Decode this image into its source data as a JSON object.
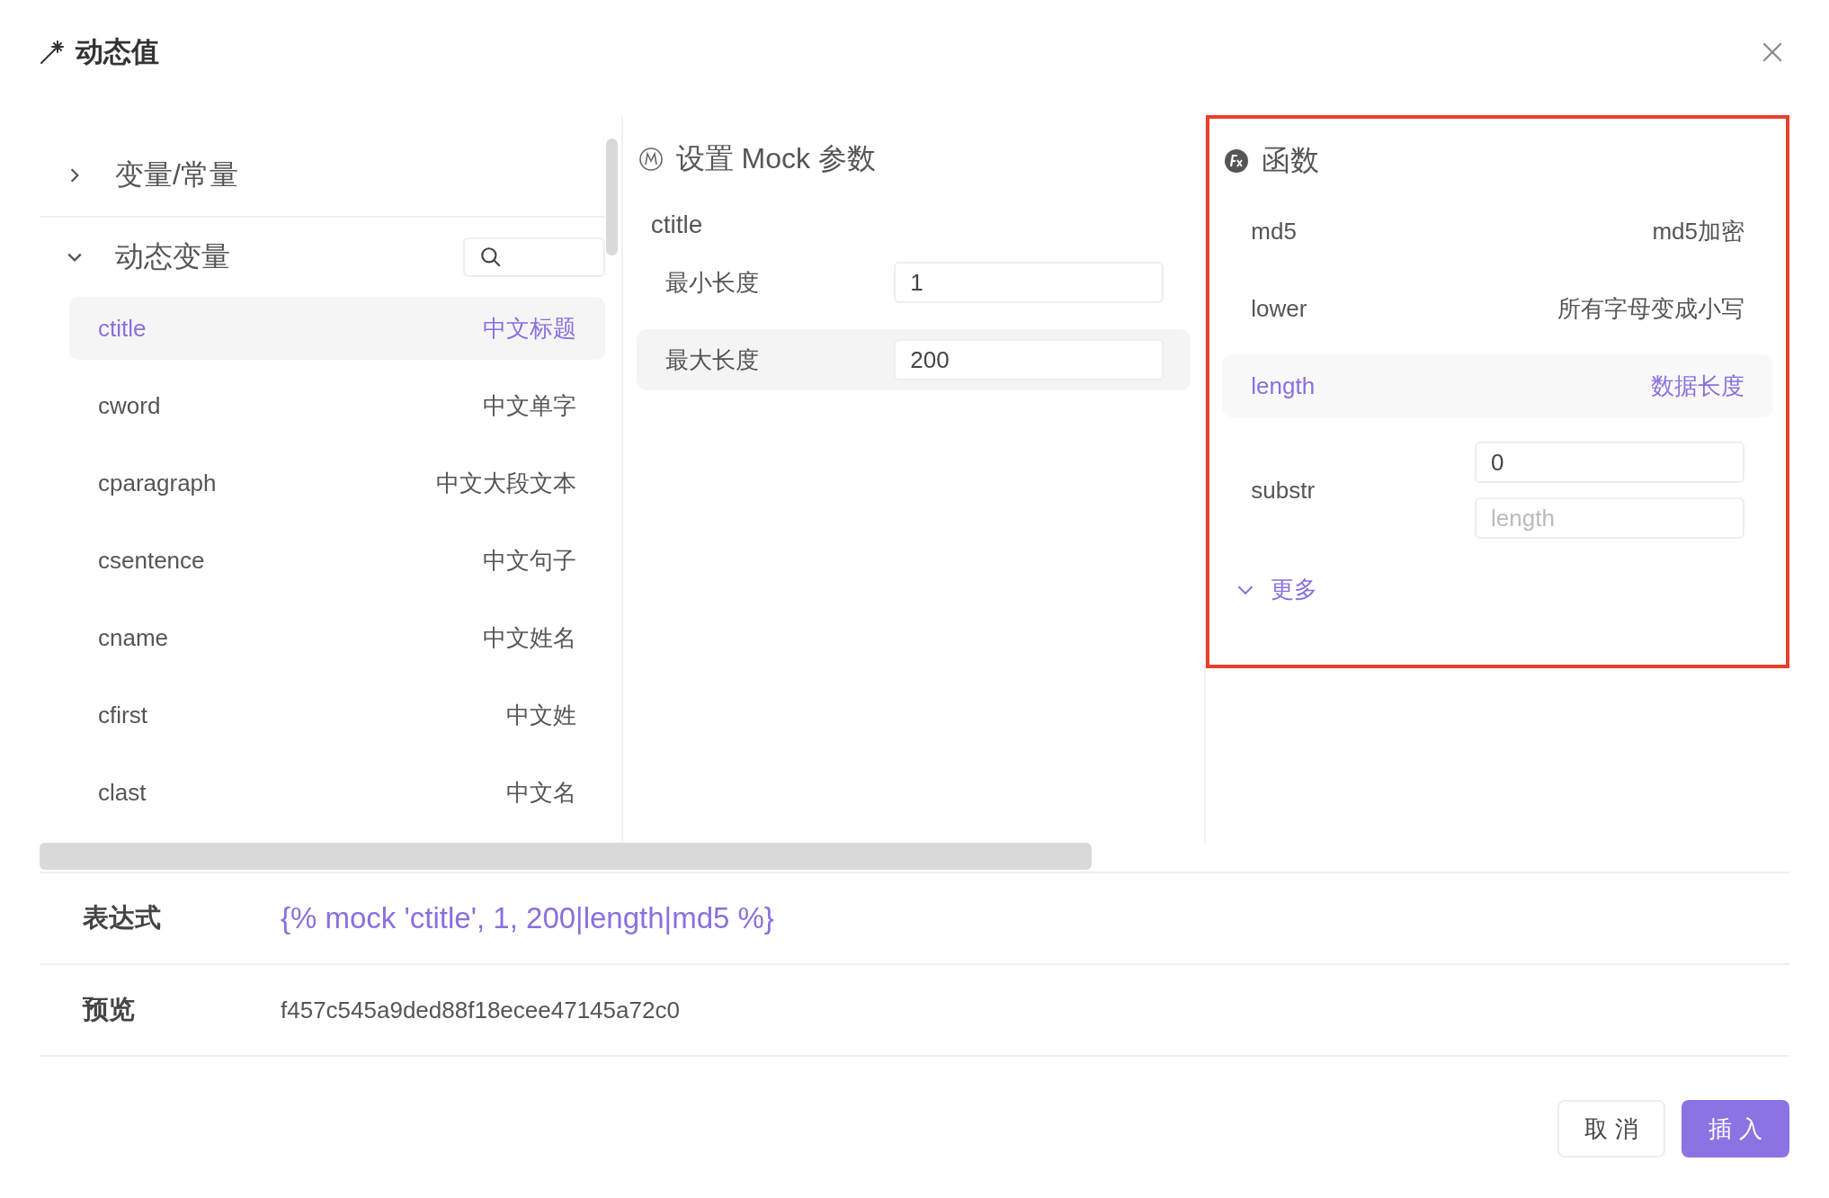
{
  "dialog": {
    "title": "动态值"
  },
  "variables": {
    "groups": [
      {
        "label": "变量/常量",
        "expanded": false
      },
      {
        "label": "动态变量",
        "expanded": true,
        "items": [
          {
            "name": "ctitle",
            "desc": "中文标题",
            "selected": true
          },
          {
            "name": "cword",
            "desc": "中文单字",
            "selected": false
          },
          {
            "name": "cparagraph",
            "desc": "中文大段文本",
            "selected": false
          },
          {
            "name": "csentence",
            "desc": "中文句子",
            "selected": false
          },
          {
            "name": "cname",
            "desc": "中文姓名",
            "selected": false
          },
          {
            "name": "cfirst",
            "desc": "中文姓",
            "selected": false
          },
          {
            "name": "clast",
            "desc": "中文名",
            "selected": false
          }
        ]
      }
    ]
  },
  "mock": {
    "title": "设置 Mock 参数",
    "variable": "ctitle",
    "params": [
      {
        "label": "最小长度",
        "value": "1",
        "selected": false
      },
      {
        "label": "最大长度",
        "value": "200",
        "selected": true
      }
    ]
  },
  "functions": {
    "title": "函数",
    "highlighted": true,
    "items": [
      {
        "kind": "plain",
        "name": "md5",
        "desc": "md5加密",
        "selected": false
      },
      {
        "kind": "plain",
        "name": "lower",
        "desc": "所有字母变成小写",
        "selected": false
      },
      {
        "kind": "plain",
        "name": "length",
        "desc": "数据长度",
        "selected": true
      },
      {
        "kind": "params",
        "name": "substr",
        "selected": false,
        "fields": [
          {
            "value": "0"
          },
          {
            "placeholder": "length"
          }
        ]
      }
    ],
    "more": "更多"
  },
  "expression": {
    "label": "表达式",
    "value": "{% mock 'ctitle', 1, 200|length|md5 %}"
  },
  "preview": {
    "label": "预览",
    "value": "f457c545a9ded88f18ecee47145a72c0"
  },
  "buttons": [
    {
      "label": "取 消",
      "kind": "secondary"
    },
    {
      "label": "插 入",
      "kind": "primary"
    }
  ]
}
